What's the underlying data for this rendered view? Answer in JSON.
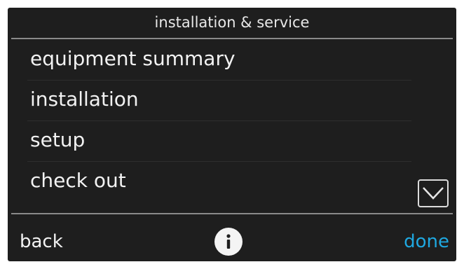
{
  "header": {
    "title": "installation & service"
  },
  "menu": {
    "items": [
      {
        "label": "equipment summary"
      },
      {
        "label": "installation"
      },
      {
        "label": "setup"
      },
      {
        "label": "check out"
      }
    ]
  },
  "footer": {
    "back_label": "back",
    "done_label": "done",
    "info_icon": "info-icon"
  },
  "colors": {
    "background": "#1e1e1e",
    "text": "#f2f2f2",
    "accent": "#1fa8e0",
    "rule": "#8a8a8a"
  }
}
